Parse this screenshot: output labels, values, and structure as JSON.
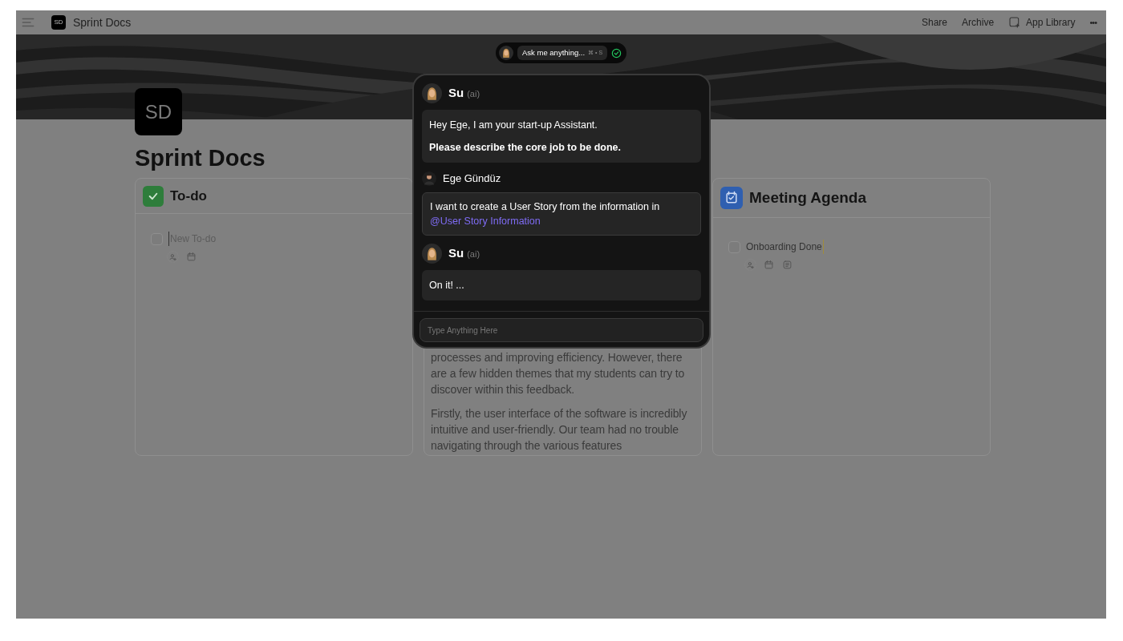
{
  "topbar": {
    "doc_initials": "SD",
    "doc_title": "Sprint Docs",
    "actions": [
      "Share",
      "Archive",
      "App Library"
    ],
    "more": "•••"
  },
  "ask_pill": {
    "placeholder": "Ask me anything...",
    "shortcut": "⌘ • S"
  },
  "page": {
    "initials": "SD",
    "title": "Sprint Docs"
  },
  "boards": [
    {
      "kind": "todo",
      "title": "To-do",
      "items": [
        {
          "placeholder": "New To-do",
          "checked": false,
          "has_notes": false
        }
      ]
    },
    {
      "kind": "text",
      "paragraphs": [
        "processes and improving efficiency. However, there are a few hidden themes that my students can try to discover within this feedback.",
        "Firstly, the user interface of the software is incredibly intuitive and user-friendly. Our team had no trouble navigating through the various features"
      ]
    },
    {
      "kind": "agenda",
      "title": "Meeting Agenda",
      "items": [
        {
          "text": "Onboarding Done",
          "checked": false,
          "has_notes": true
        }
      ]
    }
  ],
  "chat": {
    "messages": [
      {
        "kind": "ai",
        "author": "Su",
        "role": "(ai)",
        "paragraphs": [
          {
            "text": "Hey Ege, I am your start-up Assistant.",
            "bold": false
          },
          {
            "text": "Please describe the core job to be done.",
            "bold": true
          }
        ]
      },
      {
        "kind": "user",
        "author": "Ege Gündüz",
        "text": "I want to create a User Story from the information in",
        "mention": "@User Story Information"
      },
      {
        "kind": "ai",
        "author": "Su",
        "role": "(ai)",
        "paragraphs": [
          {
            "text": "On it! ...",
            "bold": false
          }
        ]
      }
    ],
    "input_placeholder": "Type Anything Here"
  }
}
